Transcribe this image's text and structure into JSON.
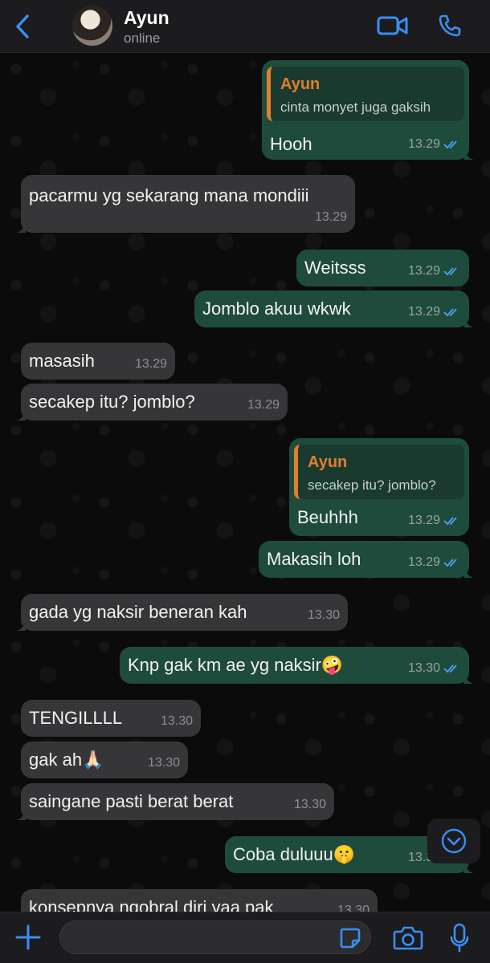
{
  "header": {
    "contact_name": "Ayun",
    "status": "online"
  },
  "colors": {
    "accent": "#3b8ef5",
    "incoming_bubble": "#363638",
    "outgoing_bubble": "#1f4b3d",
    "quote_name": "#e0802a"
  },
  "messages": [
    {
      "dir": "out",
      "quote_name": "Ayun",
      "quote_text": "cinta monyet juga gaksih",
      "text": "Hooh",
      "time": "13.29",
      "read": true
    },
    {
      "dir": "in",
      "text": "pacarmu yg sekarang mana mondiii",
      "time": "13.29"
    },
    {
      "dir": "out",
      "text": "Weitsss",
      "time": "13.29",
      "read": true
    },
    {
      "dir": "out",
      "text": "Jomblo akuu wkwk",
      "time": "13.29",
      "read": true
    },
    {
      "dir": "in",
      "text": "masasih",
      "time": "13.29"
    },
    {
      "dir": "in",
      "text": "secakep itu? jomblo?",
      "time": "13.29"
    },
    {
      "dir": "out",
      "quote_name": "Ayun",
      "quote_text": "secakep itu? jomblo?",
      "text": "Beuhhh",
      "time": "13.29",
      "read": true
    },
    {
      "dir": "out",
      "text": "Makasih loh",
      "time": "13.29",
      "read": true
    },
    {
      "dir": "in",
      "text": "gada yg naksir beneran kah",
      "time": "13.30"
    },
    {
      "dir": "out",
      "text": "Knp gak km ae yg naksir🤪",
      "time": "13.30",
      "read": true
    },
    {
      "dir": "in",
      "text": "TENGILLLL",
      "time": "13.30"
    },
    {
      "dir": "in",
      "text": "gak ah🙏🏻",
      "time": "13.30"
    },
    {
      "dir": "in",
      "text": "saingane pasti berat berat",
      "time": "13.30"
    },
    {
      "dir": "out",
      "text": "Coba duluuu🤫",
      "time": "13.30",
      "read": true
    },
    {
      "dir": "in",
      "text": "konsepnya ngobral diri yaa pak",
      "time": "13.30"
    }
  ],
  "composer": {
    "placeholder": ""
  },
  "icons": [
    "back-chevron-icon",
    "video-call-icon",
    "phone-icon",
    "plus-icon",
    "sticker-icon",
    "camera-icon",
    "microphone-icon",
    "chevron-down-icon",
    "double-check-icon"
  ]
}
